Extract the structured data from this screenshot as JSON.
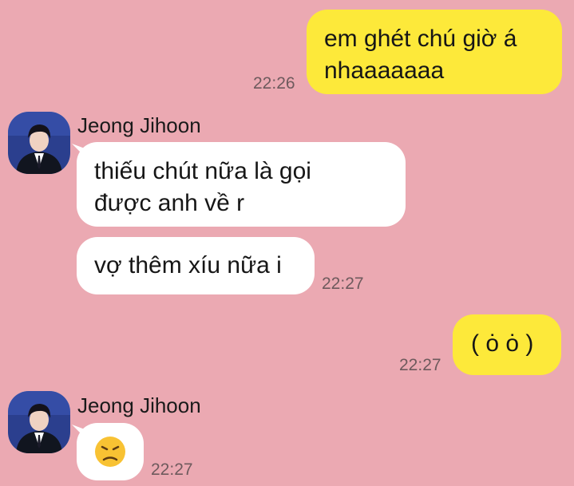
{
  "messages": [
    {
      "id": "m1",
      "side": "sent",
      "text": "em ghét chú giờ á\nnhaaaaaaa",
      "time": "22:26"
    },
    {
      "id": "m2",
      "side": "received",
      "sender": "Jeong Jihoon",
      "text": "thiếu chút nữa là gọi\nđược anh về r"
    },
    {
      "id": "m3",
      "side": "received",
      "text": "vợ thêm xíu nữa i",
      "time": "22:27"
    },
    {
      "id": "m4",
      "side": "sent",
      "text": "( ȯ ȯ )",
      "time": "22:27"
    },
    {
      "id": "m5",
      "side": "received",
      "sender": "Jeong Jihoon",
      "emoji": "disappointed-face",
      "time": "22:27"
    }
  ],
  "colors": {
    "background": "#eba9b2",
    "sent_bubble": "#fde93a",
    "received_bubble": "#ffffff"
  }
}
